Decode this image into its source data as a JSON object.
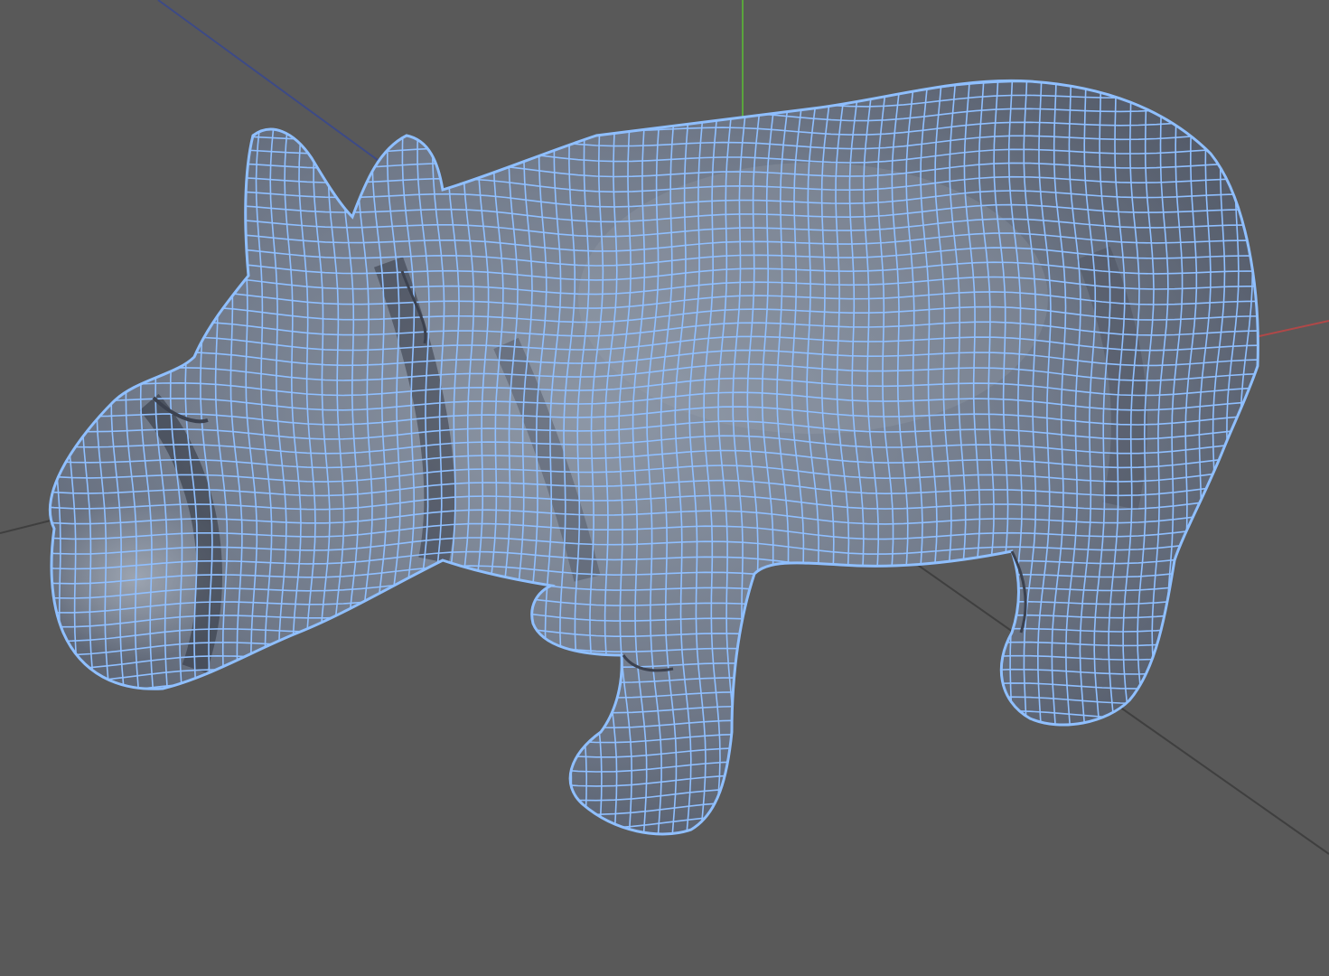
{
  "viewport": {
    "view": "perspective",
    "shading": "smooth-shade-with-wireframe",
    "colors": {
      "background": "#595959",
      "wireframe": "#8fbfff",
      "mesh_fill": "#7c8593",
      "mesh_shadow": "#3c4250",
      "axis_x": "#b04848",
      "axis_y": "#5aa53c",
      "axis_z": "#3d4a86",
      "ground_grid": "#3f3f3f"
    },
    "model": {
      "name": "",
      "icon": "rhino-mesh-icon",
      "selected": true
    },
    "axes": [
      "x",
      "y",
      "z"
    ]
  }
}
